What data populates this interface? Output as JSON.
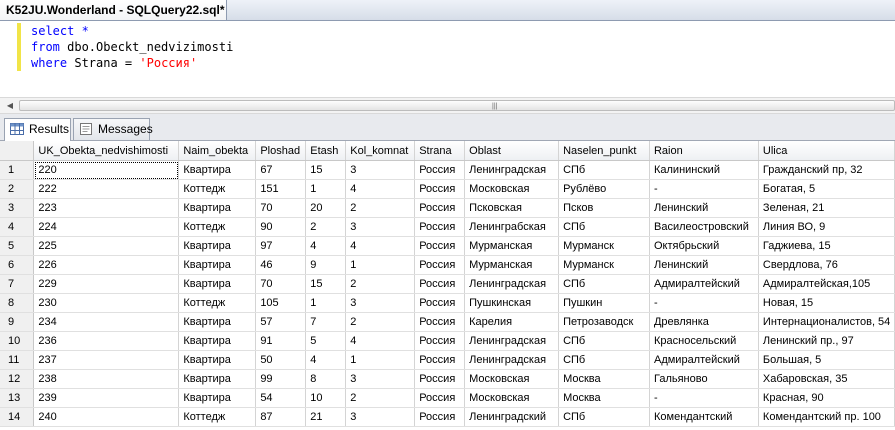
{
  "window": {
    "doc_tab_title": "K52JU.Wonderland - SQLQuery22.sql*",
    "close_glyph": "×"
  },
  "editor": {
    "lines": [
      [
        {
          "t": "select *",
          "c": "kw"
        }
      ],
      [
        {
          "t": "from ",
          "c": "kw"
        },
        {
          "t": "dbo.Obeckt_nedvizimosti",
          "c": "pl"
        }
      ],
      [
        {
          "t": "where ",
          "c": "kw"
        },
        {
          "t": "Strana = ",
          "c": "pl"
        },
        {
          "t": "'Россия'",
          "c": "str"
        }
      ]
    ]
  },
  "result_tabs": [
    {
      "label": "Results",
      "icon": "grid-icon",
      "active": true
    },
    {
      "label": "Messages",
      "icon": "messages-icon",
      "active": false
    }
  ],
  "grid": {
    "columns": [
      "UK_Obekta_nedvishimosti",
      "Naim_obekta",
      "Ploshad",
      "Etash",
      "Kol_komnat",
      "Strana",
      "Oblast",
      "Naselen_punkt",
      "Raion",
      "Ulica"
    ],
    "rows": [
      [
        "1",
        "220",
        "Квартира",
        "67",
        "15",
        "3",
        "Россия",
        "Ленинградская",
        "СПб",
        "Калининский",
        "Гражданский пр, 32"
      ],
      [
        "2",
        "222",
        "Коттедж",
        "151",
        "1",
        "4",
        "Россия",
        "Московская",
        "Рублёво",
        "-",
        "Богатая, 5"
      ],
      [
        "3",
        "223",
        "Квартира",
        "70",
        "20",
        "2",
        "Россия",
        "Псковская",
        "Псков",
        "Ленинский",
        "Зеленая, 21"
      ],
      [
        "4",
        "224",
        "Коттедж",
        "90",
        "2",
        "3",
        "Россия",
        "Ленинграбская",
        "СПб",
        "Василеостровский",
        "Линия ВО, 9"
      ],
      [
        "5",
        "225",
        "Квартира",
        "97",
        "4",
        "4",
        "Россия",
        "Мурманская",
        "Мурманск",
        "Октябрьский",
        "Гаджиева, 15"
      ],
      [
        "6",
        "226",
        "Квартира",
        "46",
        "9",
        "1",
        "Россия",
        "Мурманская",
        "Мурманск",
        "Ленинский",
        "Свердлова, 76"
      ],
      [
        "7",
        "229",
        "Квартира",
        "70",
        "15",
        "2",
        "Россия",
        "Ленинградская",
        "СПб",
        "Адмиралтейский",
        "Адмиралтейская,105"
      ],
      [
        "8",
        "230",
        "Коттедж",
        "105",
        "1",
        "3",
        "Россия",
        "Пушкинская",
        "Пушкин",
        "-",
        "Новая, 15"
      ],
      [
        "9",
        "234",
        "Квартира",
        "57",
        "7",
        "2",
        "Россия",
        "Карелия",
        "Петрозаводск",
        "Древлянка",
        "Интернационалистов, 54"
      ],
      [
        "10",
        "236",
        "Квартира",
        "91",
        "5",
        "4",
        "Россия",
        "Ленинградская",
        "СПб",
        "Красносельский",
        "Ленинский пр., 97"
      ],
      [
        "11",
        "237",
        "Квартира",
        "50",
        "4",
        "1",
        "Россия",
        "Ленинградская",
        "СПб",
        "Адмиралтейский",
        "Большая, 5"
      ],
      [
        "12",
        "238",
        "Квартира",
        "99",
        "8",
        "3",
        "Россия",
        "Московская",
        "Москва",
        "Гальяново",
        "Хабаровская, 35"
      ],
      [
        "13",
        "239",
        "Квартира",
        "54",
        "10",
        "2",
        "Россия",
        "Московская",
        "Москва",
        "-",
        "Красная, 90"
      ],
      [
        "14",
        "240",
        "Коттедж",
        "87",
        "21",
        "3",
        "Россия",
        "Ленинградский",
        "СПб",
        "Комендантский",
        "Комендантский пр. 100"
      ]
    ]
  }
}
